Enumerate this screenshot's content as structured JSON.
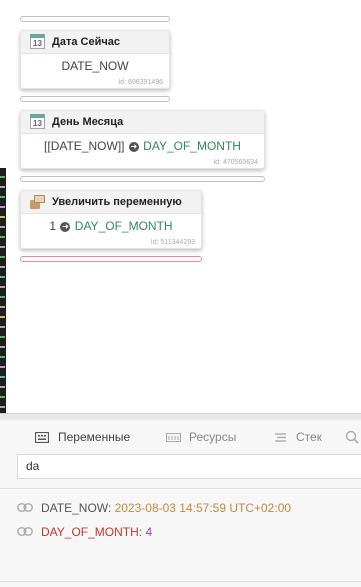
{
  "blocks": [
    {
      "title": "Дата Сейчас",
      "body": "DATE_NOW",
      "id": "Id: 696391496",
      "icon": "calendar-icon",
      "icon_text": "13"
    },
    {
      "title": "День Месяца",
      "body_prefix": "[[DATE_NOW]]",
      "body_var": "DAY_OF_MONTH",
      "id": "Id: 470569634",
      "icon": "calendar-icon",
      "icon_text": "13"
    },
    {
      "title": "Увеличить переменную",
      "body_prefix": "1",
      "body_var": "DAY_OF_MONTH",
      "id": "Id: 511344293",
      "icon": "increment-icon"
    }
  ],
  "tabs": [
    {
      "label": "Переменные",
      "icon": "keyboard-icon",
      "active": true
    },
    {
      "label": "Ресурсы",
      "icon": "memory-icon",
      "active": false
    },
    {
      "label": "Стек",
      "icon": "stack-icon",
      "active": false
    }
  ],
  "search": {
    "value": "da",
    "icon": "search-icon"
  },
  "variables": [
    {
      "name": "DATE_NOW:",
      "value": "2023-08-03 14:57:59 UTC+02:00",
      "icon": "link-icon",
      "name_color": "#555555",
      "value_color": "#c28a3d"
    },
    {
      "name": "DAY_OF_MONTH:",
      "value": "4",
      "icon": "link-icon",
      "name_color": "#c0392b",
      "value_color": "#a03eb0"
    }
  ]
}
